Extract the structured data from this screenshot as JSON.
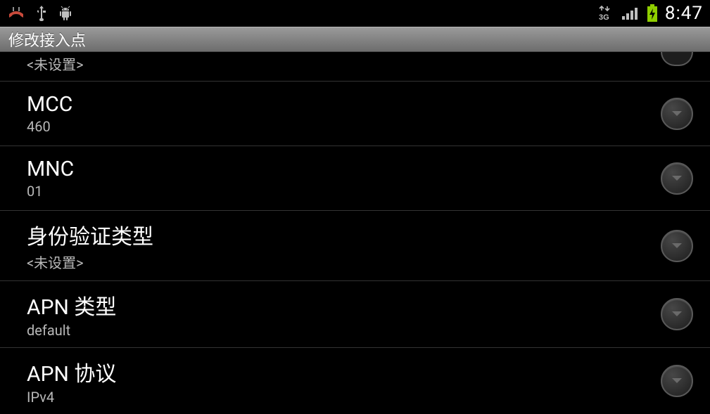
{
  "status_bar": {
    "time": "8:47"
  },
  "title_bar": {
    "title": "修改接入点"
  },
  "items": [
    {
      "title": "",
      "value": "<未设置>"
    },
    {
      "title": "MCC",
      "value": "460"
    },
    {
      "title": "MNC",
      "value": "01"
    },
    {
      "title": "身份验证类型",
      "value": "<未设置>"
    },
    {
      "title": "APN 类型",
      "value": "default"
    },
    {
      "title": "APN 协议",
      "value": "IPv4"
    }
  ]
}
